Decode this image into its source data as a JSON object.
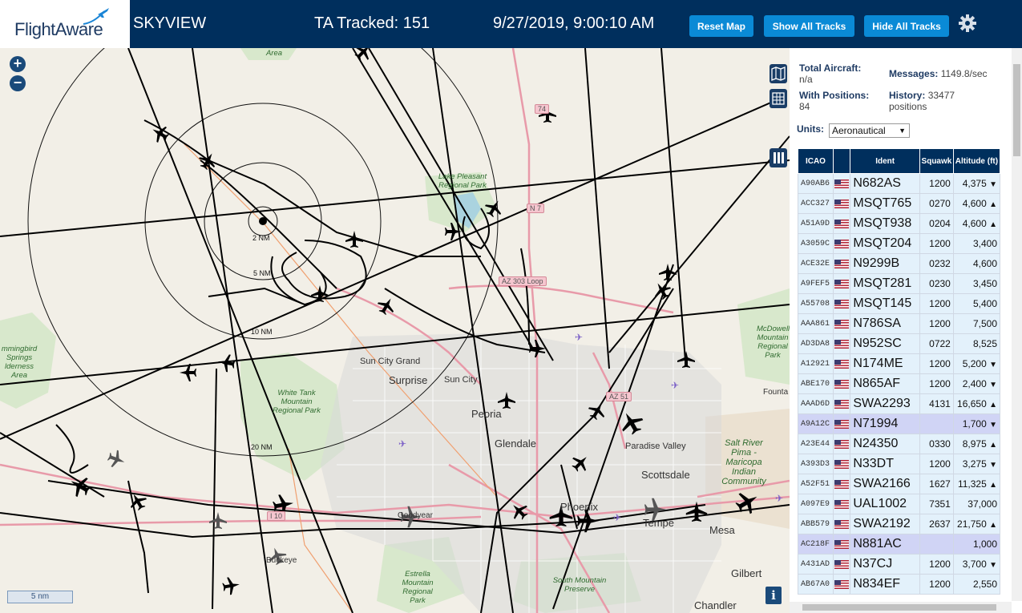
{
  "header": {
    "logo_text": "FlightAware",
    "app_title": "SKYVIEW",
    "tracked_label": "TA Tracked: 151",
    "datetime": "9/27/2019, 9:00:10 AM",
    "buttons": {
      "reset": "Reset Map",
      "show": "Show All Tracks",
      "hide": "Hide All Tracks"
    },
    "settings_icon": "gear-icon"
  },
  "map": {
    "zoom_in": "+",
    "zoom_out": "−",
    "scale_bar": "5 nm",
    "info": "i",
    "ring_labels": [
      "2 NM",
      "5 NM",
      "10 NM",
      "20 NM"
    ],
    "places": [
      "Sun City Grand",
      "Surprise",
      "Sun City",
      "Peoria",
      "Glendale",
      "Paradise Valley",
      "Scottsdale",
      "Phoenix",
      "Tempe",
      "Mesa",
      "Gilbert",
      "Chandler",
      "Goodyear",
      "Buckeye",
      "Founta"
    ],
    "parks": [
      "Area",
      "Lake Pleasant Regional Park",
      "White Tank Mountain Regional Park",
      "Estrella Mountain Regional Park",
      "South Mountain Preserve",
      "McDowell Mountain Regional Park",
      "Salt River Pima - Maricopa Indian Community",
      "mmingbird Springs lderness Area"
    ],
    "road_shields": [
      "AZ 303 Loop",
      "AZ 51",
      "I 10",
      "74",
      "N 7"
    ],
    "colors": {
      "land": "#f2efe7",
      "park": "#cde6c0",
      "urban": "#d9d9d9",
      "road_major": "#e89aa9",
      "track": "#000000"
    }
  },
  "sidebar": {
    "total_aircraft_label": "Total Aircraft:",
    "total_aircraft_value": "n/a",
    "messages_label": "Messages:",
    "messages_value": "1149.8/sec",
    "with_positions_label": "With Positions:",
    "with_positions_value": "84",
    "history_label": "History:",
    "history_value": "33477 positions",
    "units_label": "Units:",
    "units_value": "Aeronautical",
    "columns": [
      "ICAO",
      "",
      "Ident",
      "Squawk",
      "Altitude (ft)"
    ],
    "rows": [
      {
        "icao": "A90AB6",
        "ident": "N682AS",
        "squawk": "1200",
        "alt": "4,375",
        "trend": "▼",
        "sel": false
      },
      {
        "icao": "ACC327",
        "ident": "MSQT765",
        "squawk": "0270",
        "alt": "4,600",
        "trend": "▲",
        "sel": false
      },
      {
        "icao": "A51A9D",
        "ident": "MSQT938",
        "squawk": "0204",
        "alt": "4,600",
        "trend": "▲",
        "sel": false
      },
      {
        "icao": "A3059C",
        "ident": "MSQT204",
        "squawk": "1200",
        "alt": "3,400",
        "trend": "",
        "sel": false
      },
      {
        "icao": "ACE32E",
        "ident": "N9299B",
        "squawk": "0232",
        "alt": "4,600",
        "trend": "",
        "sel": false
      },
      {
        "icao": "A9FEF5",
        "ident": "MSQT281",
        "squawk": "0230",
        "alt": "3,450",
        "trend": "",
        "sel": false
      },
      {
        "icao": "A55708",
        "ident": "MSQT145",
        "squawk": "1200",
        "alt": "5,400",
        "trend": "",
        "sel": false
      },
      {
        "icao": "AAA861",
        "ident": "N786SA",
        "squawk": "1200",
        "alt": "7,500",
        "trend": "",
        "sel": false
      },
      {
        "icao": "AD3DA8",
        "ident": "N952SC",
        "squawk": "0722",
        "alt": "8,525",
        "trend": "",
        "sel": false
      },
      {
        "icao": "A12921",
        "ident": "N174ME",
        "squawk": "1200",
        "alt": "5,200",
        "trend": "▼",
        "sel": false
      },
      {
        "icao": "ABE170",
        "ident": "N865AF",
        "squawk": "1200",
        "alt": "2,400",
        "trend": "▼",
        "sel": false
      },
      {
        "icao": "AAAD6D",
        "ident": "SWA2293",
        "squawk": "4131",
        "alt": "16,650",
        "trend": "▲",
        "sel": false
      },
      {
        "icao": "A9A12C",
        "ident": "N71994",
        "squawk": "",
        "alt": "1,700",
        "trend": "▼",
        "sel": true
      },
      {
        "icao": "A23E44",
        "ident": "N24350",
        "squawk": "0330",
        "alt": "8,975",
        "trend": "▲",
        "sel": false
      },
      {
        "icao": "A393D3",
        "ident": "N33DT",
        "squawk": "1200",
        "alt": "3,275",
        "trend": "▼",
        "sel": false
      },
      {
        "icao": "A52F51",
        "ident": "SWA2166",
        "squawk": "1627",
        "alt": "11,325",
        "trend": "▲",
        "sel": false
      },
      {
        "icao": "A097E9",
        "ident": "UAL1002",
        "squawk": "7351",
        "alt": "37,000",
        "trend": "",
        "sel": false
      },
      {
        "icao": "ABB579",
        "ident": "SWA2192",
        "squawk": "2637",
        "alt": "21,750",
        "trend": "▲",
        "sel": false
      },
      {
        "icao": "AC218F",
        "ident": "N881AC",
        "squawk": "",
        "alt": "1,000",
        "trend": "",
        "sel": true
      },
      {
        "icao": "A431AD",
        "ident": "N37CJ",
        "squawk": "1200",
        "alt": "3,700",
        "trend": "▼",
        "sel": false
      },
      {
        "icao": "AB67A0",
        "ident": "N834EF",
        "squawk": "1200",
        "alt": "2,550",
        "trend": "",
        "sel": false
      }
    ]
  }
}
